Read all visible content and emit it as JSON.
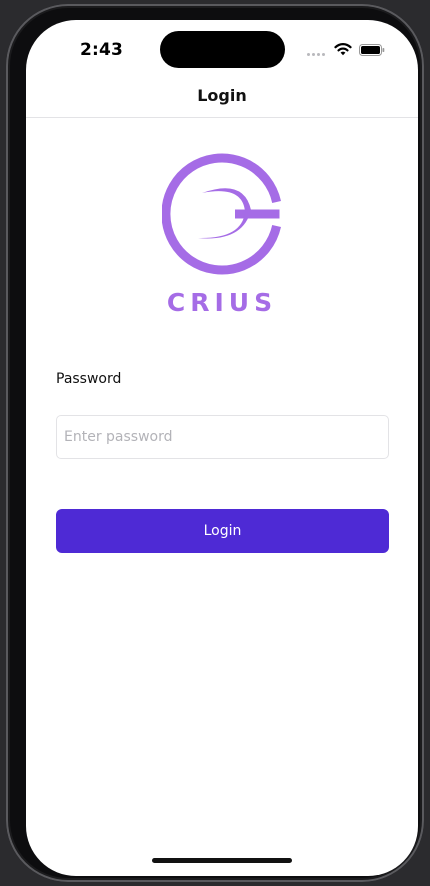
{
  "status_bar": {
    "time": "2:43"
  },
  "nav": {
    "title": "Login"
  },
  "brand": {
    "name": "CRIUS",
    "color": "#a56ce6"
  },
  "form": {
    "password_label": "Password",
    "password_placeholder": "Enter password",
    "password_value": "",
    "login_label": "Login",
    "accent_color": "#4e2ad5"
  },
  "icons": [
    "signal-icon",
    "wifi-icon",
    "battery-icon",
    "crius-logo"
  ]
}
